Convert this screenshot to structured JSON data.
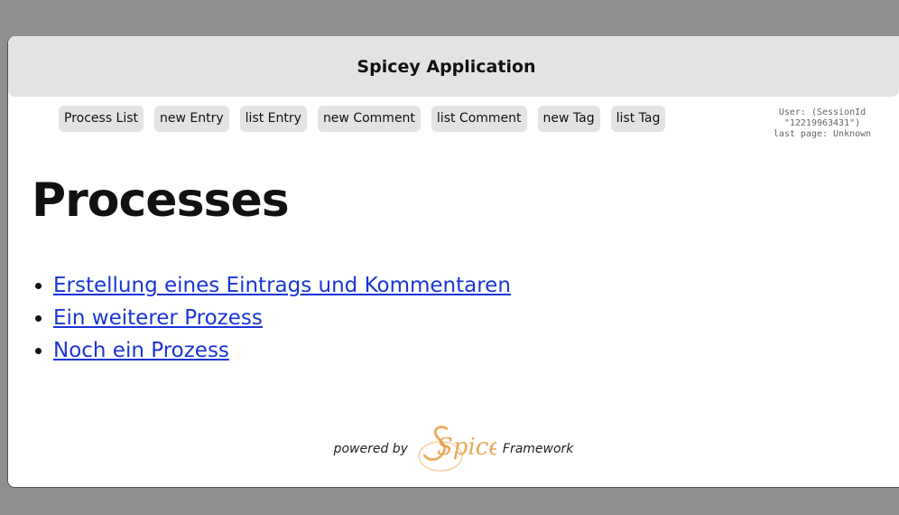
{
  "header": {
    "title": "Spicey Application"
  },
  "nav": {
    "items": [
      {
        "label": "Process List"
      },
      {
        "label": "new Entry"
      },
      {
        "label": "list Entry"
      },
      {
        "label": "new Comment"
      },
      {
        "label": "list Comment"
      },
      {
        "label": "new Tag"
      },
      {
        "label": "list Tag"
      }
    ]
  },
  "session": {
    "line1": "User: (SessionId",
    "line2": "\"12219963431\")",
    "line3": "last page: Unknown"
  },
  "main": {
    "heading": "Processes",
    "processes": [
      {
        "label": "Erstellung eines Eintrags und Kommentaren"
      },
      {
        "label": "Ein weiterer Prozess"
      },
      {
        "label": "Noch ein Prozess"
      }
    ]
  },
  "footer": {
    "powered_by": "powered by",
    "logo_text": "Spicey",
    "framework": "Framework"
  },
  "colors": {
    "background": "#8f8f8f",
    "header": "#e3e3e3",
    "link": "#1a35d6",
    "logo": "#e8a04a"
  }
}
